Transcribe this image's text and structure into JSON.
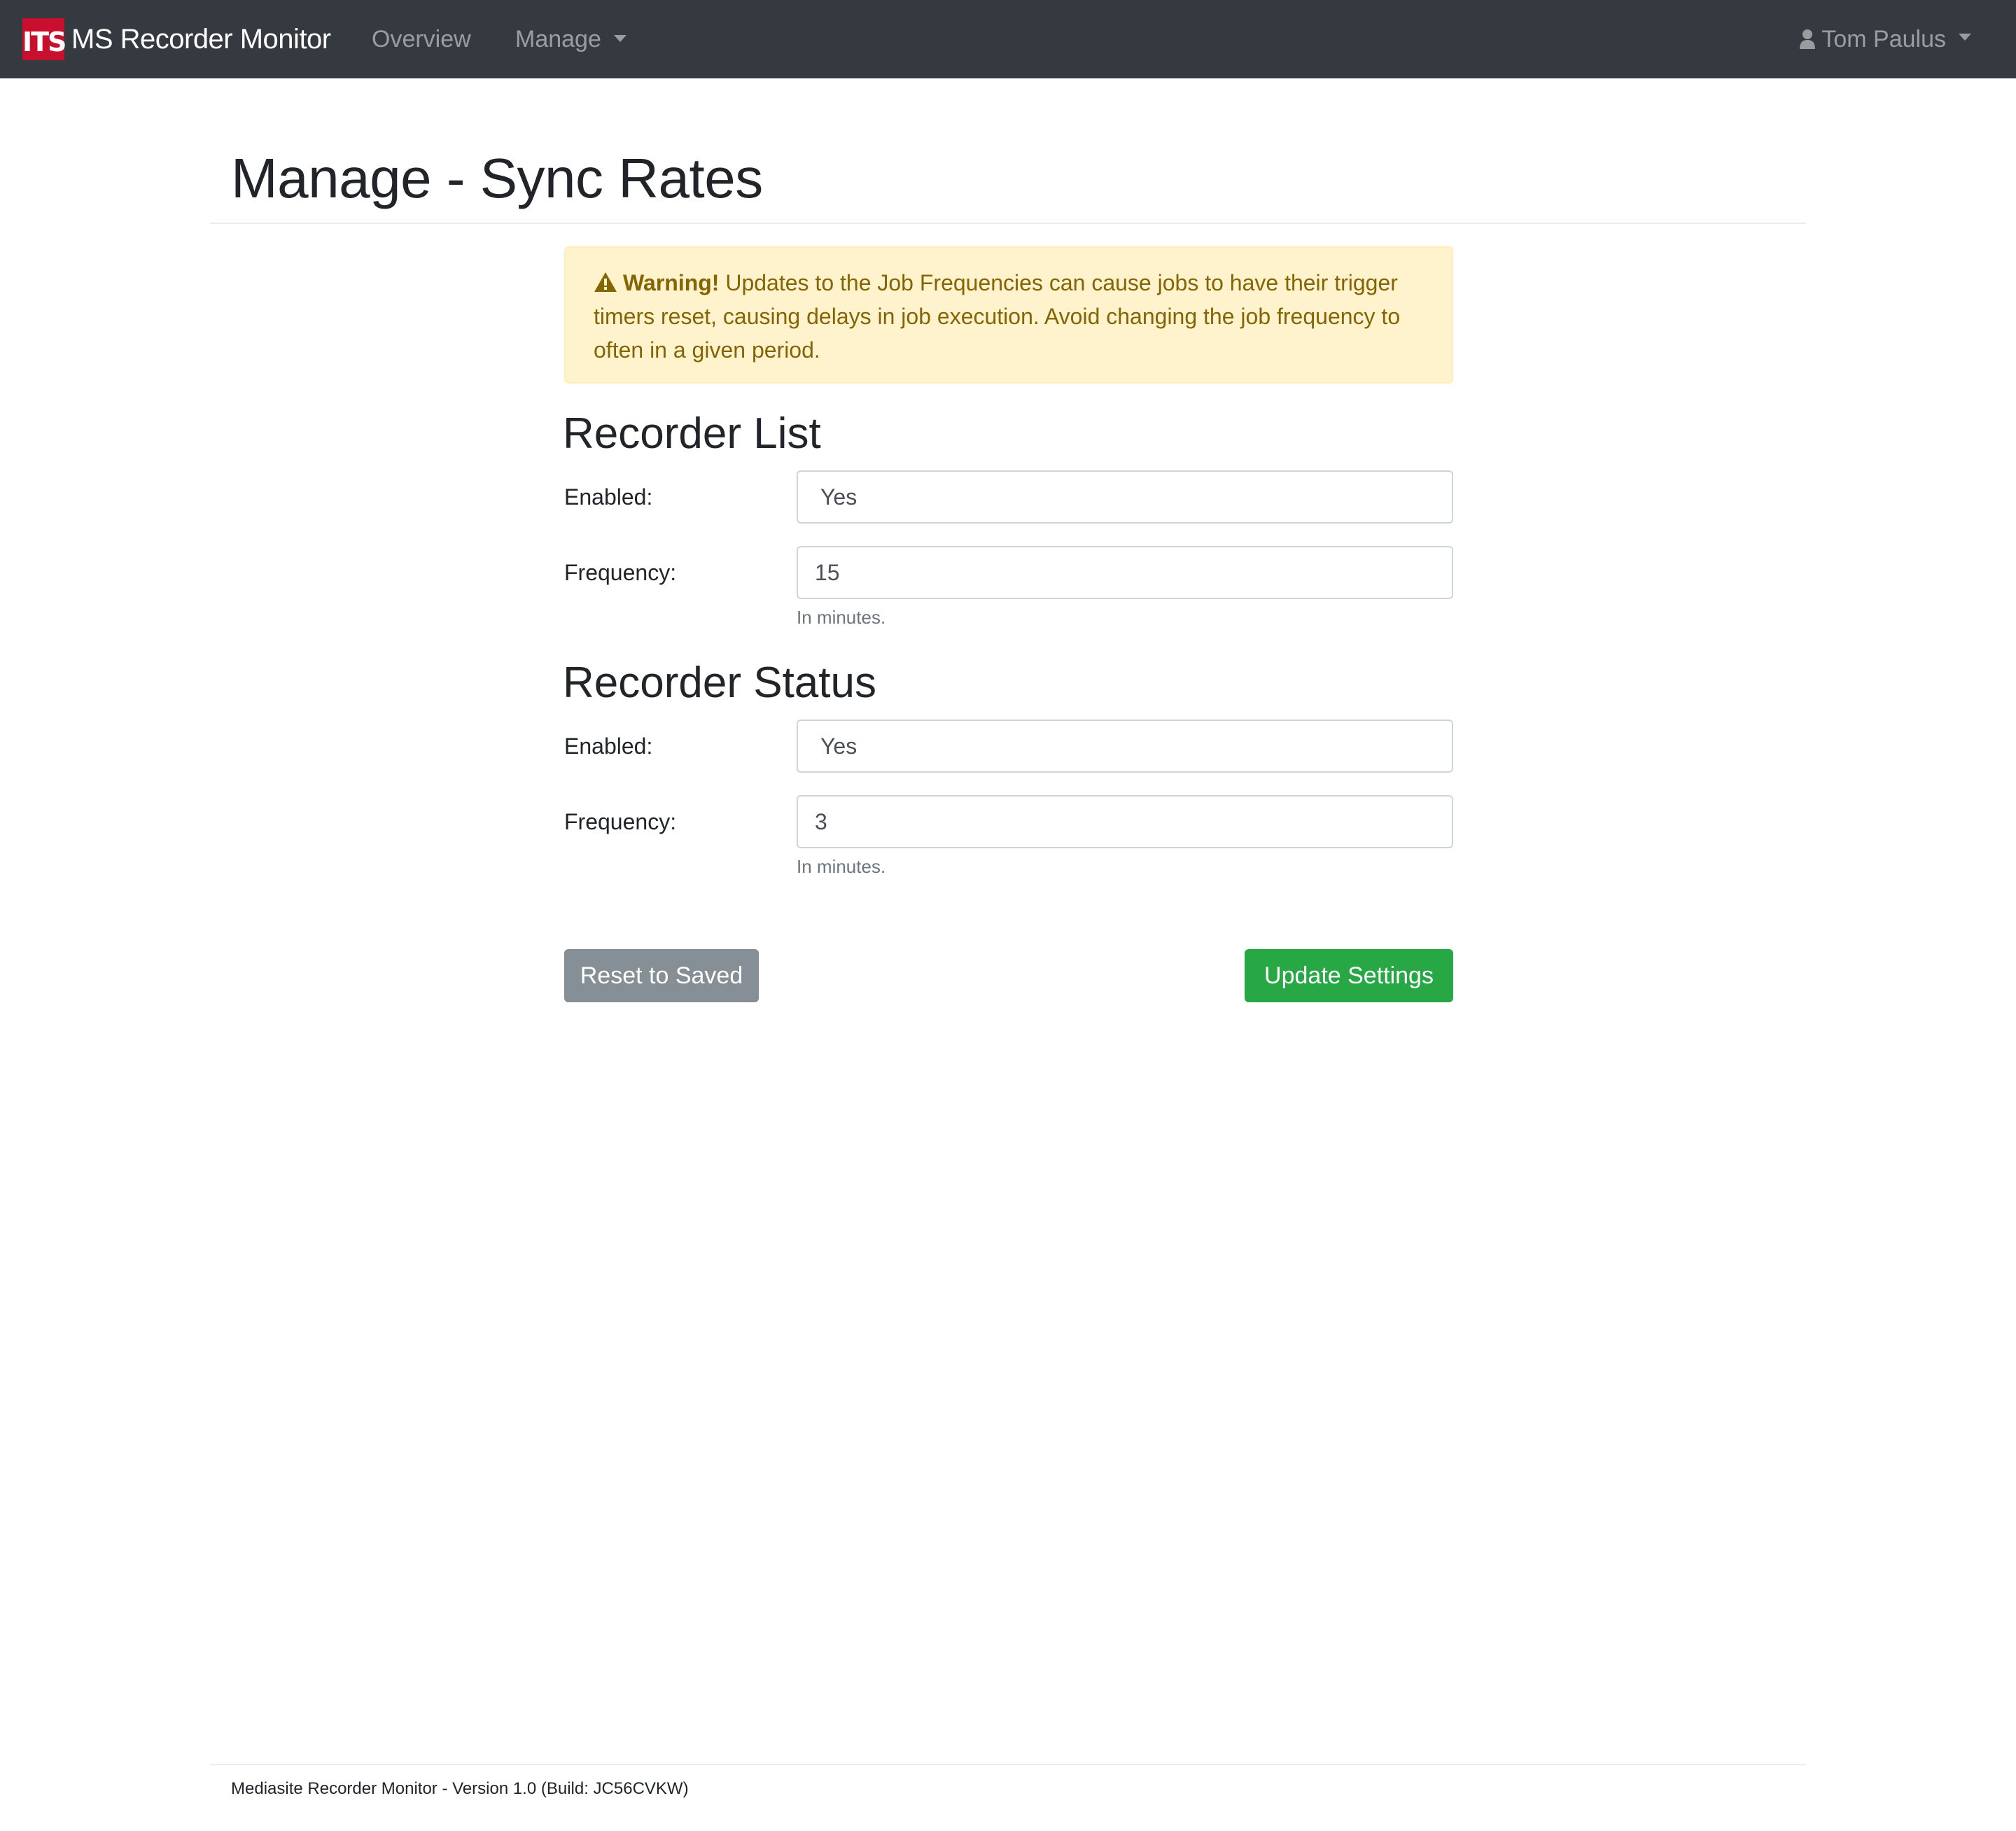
{
  "navbar": {
    "logo_text": "ITS",
    "brand": "MS Recorder Monitor",
    "links": [
      {
        "label": "Overview"
      },
      {
        "label": "Manage"
      }
    ],
    "user_name": "Tom Paulus"
  },
  "page": {
    "title": "Manage - Sync Rates"
  },
  "alert": {
    "strong": "Warning!",
    "message": "Updates to the Job Frequencies can cause jobs to have their trigger timers reset, causing delays in job execution. Avoid changing the job frequency to often in a given period."
  },
  "sections": [
    {
      "heading": "Recorder List",
      "enabled_label": "Enabled:",
      "enabled_value": "Yes",
      "frequency_label": "Frequency:",
      "frequency_value": "15",
      "help": "In minutes."
    },
    {
      "heading": "Recorder Status",
      "enabled_label": "Enabled:",
      "enabled_value": "Yes",
      "frequency_label": "Frequency:",
      "frequency_value": "3",
      "help": "In minutes."
    }
  ],
  "buttons": {
    "reset": "Reset to Saved",
    "update": "Update Settings"
  },
  "footer": {
    "text": "Mediasite Recorder Monitor - Version 1.0 (Build: JC56CVKW)"
  },
  "colors": {
    "navbar_bg": "#343a40",
    "logo_red": "#c8102e",
    "alert_bg": "#fff3cd",
    "alert_text": "#856404",
    "reset_button": "#868e96",
    "update_button": "#28a745"
  },
  "icons": {
    "user": "user-icon",
    "alert": "warning-triangle-icon",
    "dropdown": "caret-down-icon"
  }
}
